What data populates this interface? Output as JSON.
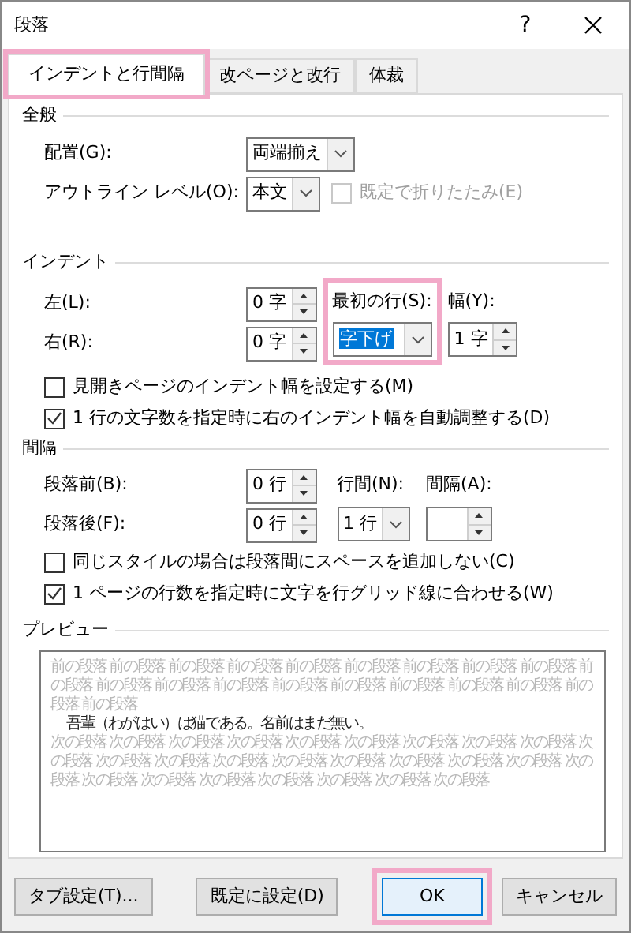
{
  "window": {
    "title": "段落",
    "help": "?"
  },
  "tabs": [
    {
      "label": "インデントと行間隔",
      "selected": true,
      "highlighted": true
    },
    {
      "label": "改ページと改行",
      "selected": false,
      "highlighted": false
    },
    {
      "label": "体裁",
      "selected": false,
      "highlighted": false
    }
  ],
  "general": {
    "heading": "全般",
    "alignment": {
      "label": "配置(G):",
      "value": "両端揃え"
    },
    "outline_level": {
      "label": "アウトライン レベル(O):",
      "value": "本文"
    },
    "collapse": {
      "label": "既定で折りたたみ(E)",
      "checked": false,
      "disabled": true
    }
  },
  "indent": {
    "heading": "インデント",
    "left": {
      "label": "左(L):",
      "value": "0 字"
    },
    "right": {
      "label": "右(R):",
      "value": "0 字"
    },
    "first_line": {
      "label": "最初の行(S):",
      "value": "字下げ",
      "focused": true,
      "highlighted": true
    },
    "by": {
      "label": "幅(Y):",
      "value": "1 字"
    },
    "checkboxes": [
      {
        "label": "見開きページのインデント幅を設定する(M)",
        "checked": false
      },
      {
        "label": "1 行の文字数を指定時に右のインデント幅を自動調整する(D)",
        "checked": true
      }
    ]
  },
  "spacing": {
    "heading": "間隔",
    "before": {
      "label": "段落前(B):",
      "value": "0 行"
    },
    "after": {
      "label": "段落後(F):",
      "value": "0 行"
    },
    "line_spacing": {
      "label": "行間(N):",
      "value": "1 行"
    },
    "at": {
      "label": "間隔(A):"
    },
    "checkboxes": [
      {
        "label": "同じスタイルの場合は段落間にスペースを追加しない(C)",
        "checked": false
      },
      {
        "label": "1 ページの行数を指定時に文字を行グリッド線に合わせる(W)",
        "checked": true
      }
    ]
  },
  "preview": {
    "heading": "プレビュー",
    "previous": [
      "前の段落 前の段落 前の段落 前の段落 前の段落 前の段落 前の段落 前の段落 前の段落 前",
      "の段落 前の段落 前の段落 前の段落 前の段落 前の段落 前の段落 前の段落 前の段落 前の",
      "段落 前の段落"
    ],
    "sample": "吾輩（わがはい）は猫である。名前はまだ無い。",
    "next": [
      "次の段落 次の段落 次の段落 次の段落 次の段落 次の段落 次の段落 次の段落 次の段落 次",
      "の段落 次の段落 次の段落 次の段落 次の段落 次の段落 次の段落 次の段落 次の段落 次の",
      "段落 次の段落 次の段落 次の段落 次の段落 次の段落 次の段落 次の段落"
    ]
  },
  "buttons": [
    {
      "label": "タブ設定(T)...",
      "default": false,
      "highlighted": false
    },
    {
      "label": "既定に設定(D)",
      "default": false,
      "highlighted": false
    },
    {
      "label": "OK",
      "default": true,
      "highlighted": true
    },
    {
      "label": "キャンセル",
      "default": false,
      "highlighted": false
    }
  ]
}
